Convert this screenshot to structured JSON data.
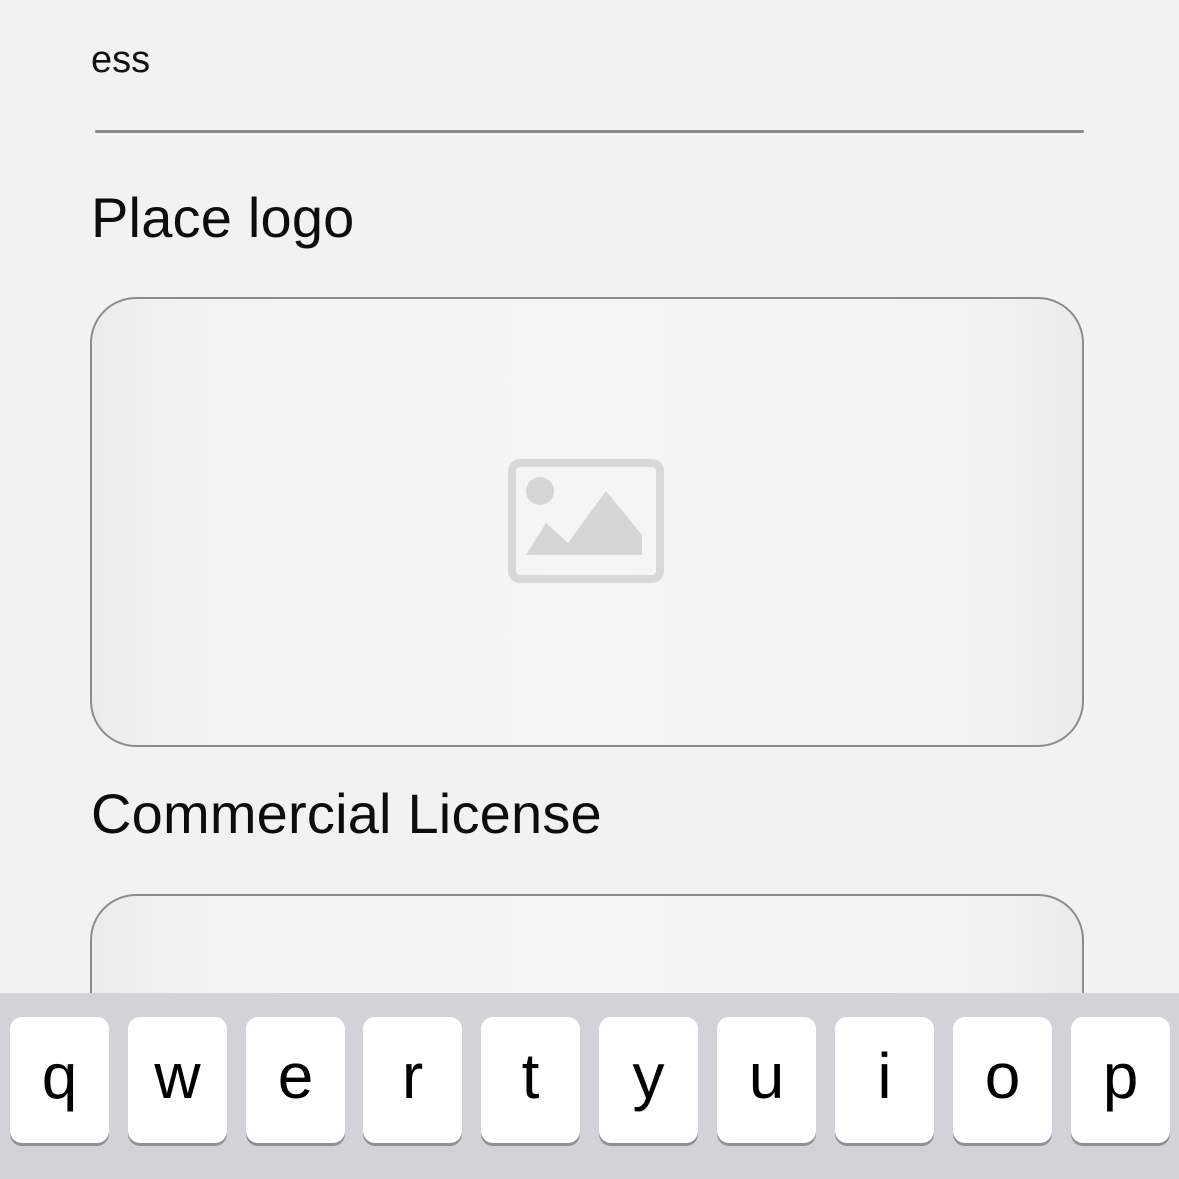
{
  "address_field": {
    "value": "ess"
  },
  "sections": {
    "logo_label": "Place logo",
    "license_label": "Commercial License"
  },
  "icons": {
    "logo_placeholder": "image-placeholder-icon"
  },
  "keyboard": {
    "row1": [
      "q",
      "w",
      "e",
      "r",
      "t",
      "y",
      "u",
      "i",
      "o",
      "p"
    ]
  },
  "colors": {
    "background": "#f2f2f2",
    "keyboard_background": "#d2d3d8",
    "key_background": "#ffffff",
    "border": "#8c8c8c",
    "placeholder_icon": "#d6d6d6"
  }
}
